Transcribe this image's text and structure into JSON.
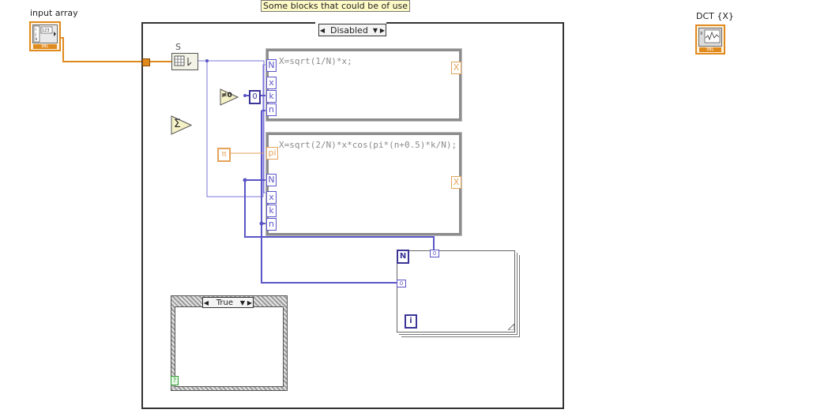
{
  "note": "Some blocks that could be of use",
  "input_terminal": {
    "label": "input array",
    "type": "DBL"
  },
  "output_terminal": {
    "label": "DCT {X}",
    "type": "DBL"
  },
  "array_size_node": {
    "label": "S"
  },
  "disabled_structure": {
    "selector_value": "Disabled"
  },
  "formula_node_1": {
    "code": "X=sqrt(1/N)*x;",
    "inputs": [
      "N",
      "x",
      "k",
      "n"
    ],
    "output": "X"
  },
  "formula_node_2": {
    "code": "X=sqrt(2/N)*x*cos(pi*(n+0.5)*k/N);",
    "inputs": [
      "pi",
      "N",
      "x",
      "k",
      "n"
    ],
    "output": "X"
  },
  "constants": {
    "zero": "0",
    "pi": "π",
    "not_equal_zero": "≠0",
    "sum": "Σ"
  },
  "for_loop": {
    "count_label": "N",
    "iteration_label": "i",
    "tunnel_label": "0"
  },
  "case_structure": {
    "selector_value": "True",
    "terminal": "?"
  },
  "colors": {
    "wire_orange": "#e08a1e",
    "wire_blue": "#5b55c7",
    "formula_border": "#8c8c8c",
    "note_bg": "#fffbc6"
  }
}
